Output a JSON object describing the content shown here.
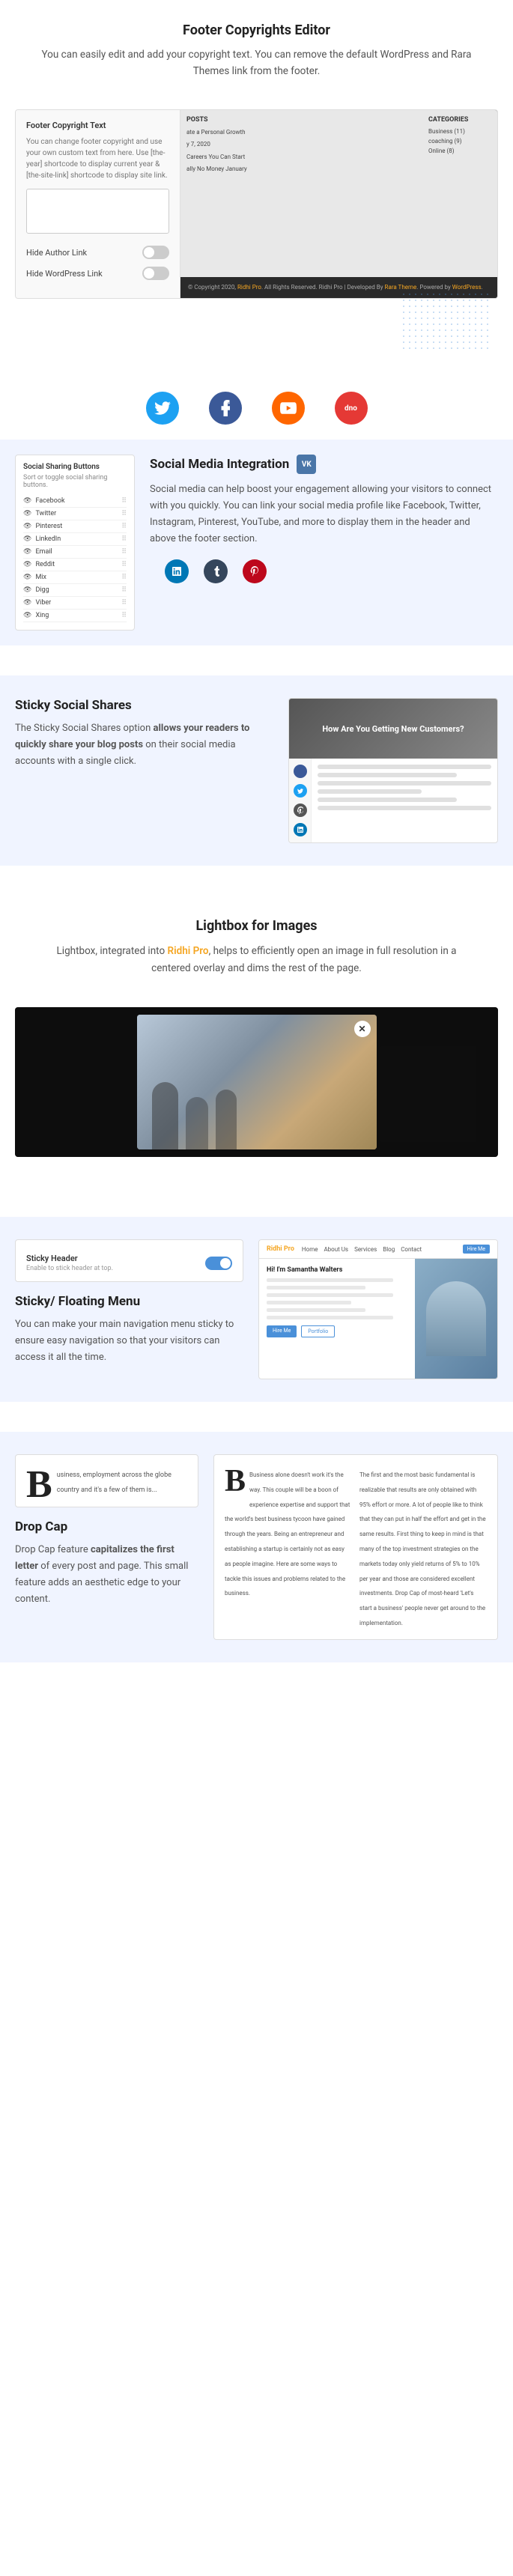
{
  "page": {
    "sections": {
      "footer_editor": {
        "title": "Footer Copyrights Editor",
        "description": "You can easily edit and add your copyright text. You can remove the default WordPress and Rara Themes link from the footer.",
        "panel": {
          "title": "Footer Copyright Text",
          "description": "You can change footer copyright and use your own custom text from here. Use [the-year] shortcode to display current year & [the-site-link] shortcode to display site link.",
          "textarea_placeholder": ""
        },
        "toggle1": {
          "label": "Hide Author Link"
        },
        "toggle2": {
          "label": "Hide WordPress Link"
        },
        "preview": {
          "posts_title": "POSTS",
          "categories_title": "CATEGORIES",
          "post1": "ate a Personal Growth",
          "post2": "y 7, 2020",
          "post3": "Careers You Can Start",
          "post4": "ally No Money January",
          "cat1": "Business (11)",
          "cat2": "coaching (9)",
          "cat3": "Online (8)",
          "footer_text": "© Copyright 2020, Ridhi Pro. All Rights Reserved. Ridhi Pro | Developed By Rara Theme. Powered by WordPress.",
          "footer_name1": "Ridhi Pro",
          "footer_name2": "Rara Theme",
          "footer_name3": "WordPress"
        }
      },
      "social_media": {
        "title": "Social Media Integration",
        "description": "Social media can help boost your engagement allowing your visitors to connect with you quickly. You can link your social media profile like Facebook, Twitter, Instagram, Pinterest, YouTube, and more to display them in the header and above the footer section.",
        "panel": {
          "title": "Social Sharing Buttons",
          "description": "Sort or toggle social sharing buttons.",
          "buttons": [
            {
              "name": "Facebook"
            },
            {
              "name": "Twitter"
            },
            {
              "name": "Pinterest"
            },
            {
              "name": "LinkedIn"
            },
            {
              "name": "Email"
            },
            {
              "name": "Reddit"
            },
            {
              "name": "Mix"
            },
            {
              "name": "Digg"
            },
            {
              "name": "Viber"
            },
            {
              "name": "Xing"
            }
          ]
        }
      },
      "sticky_shares": {
        "title": "Sticky Social Shares",
        "description_parts": {
          "prefix": "The Sticky Social Shares option ",
          "bold": "allows your readers to quickly share your blog posts",
          "suffix": " on their social media accounts with a single click."
        },
        "blog_preview_header": "How Are You Getting New Customers?"
      },
      "lightbox": {
        "title": "Lightbox for Images",
        "description_prefix": "Lightbox, integrated into ",
        "brand_name": "Ridhi Pro",
        "description_suffix": ", helps to efficiently open an image in full resolution in a centered overlay and dims the rest of the page."
      },
      "sticky_header": {
        "panel": {
          "title": "Sticky Header",
          "description": "Enable to stick header at top."
        },
        "title": "Sticky/ Floating Menu",
        "description": "You can make your main navigation menu sticky to ensure easy navigation so that your visitors can access it all the time.",
        "website_preview": {
          "logo": "Ridhi Pro",
          "nav_items": [
            "Home",
            "About Us",
            "Services",
            "Blog",
            "Contact"
          ],
          "cta": "Hire Me"
        }
      },
      "drop_cap": {
        "title": "Drop Cap",
        "description_prefix": "Drop Cap feature ",
        "bold": "capitalizes the first letter",
        "description_suffix": " of every post and page. This small feature adds an aesthetic edge to your content.",
        "preview": {
          "letter1": "B",
          "text1": "usiness, employment across the globe country and it's a few of them is...",
          "letter2": "B",
          "text2_col1": "Business alone doesn't work it's the way. This couple will be a boon of experience expertise and support that the world's best business tycoon have gained through the years. Being an entrepreneur and establishing a startup is certainly not as easy as people imagine. Here are some ways to tackle this issues and problems related to the business.",
          "text2_col2": "The first and the most basic fundamental is realizable that results are only obtained with 95% effort or more. A lot of people like to think that they can put in half the effort and get in the same results. First thing to keep in mind is that many of the top investment strategies on the markets today only yield returns of 5% to 10% per year and those are considered excellent investments. Drop Cap of most-heard 'Let's start a business' people never get around to the implementation."
        }
      }
    }
  }
}
